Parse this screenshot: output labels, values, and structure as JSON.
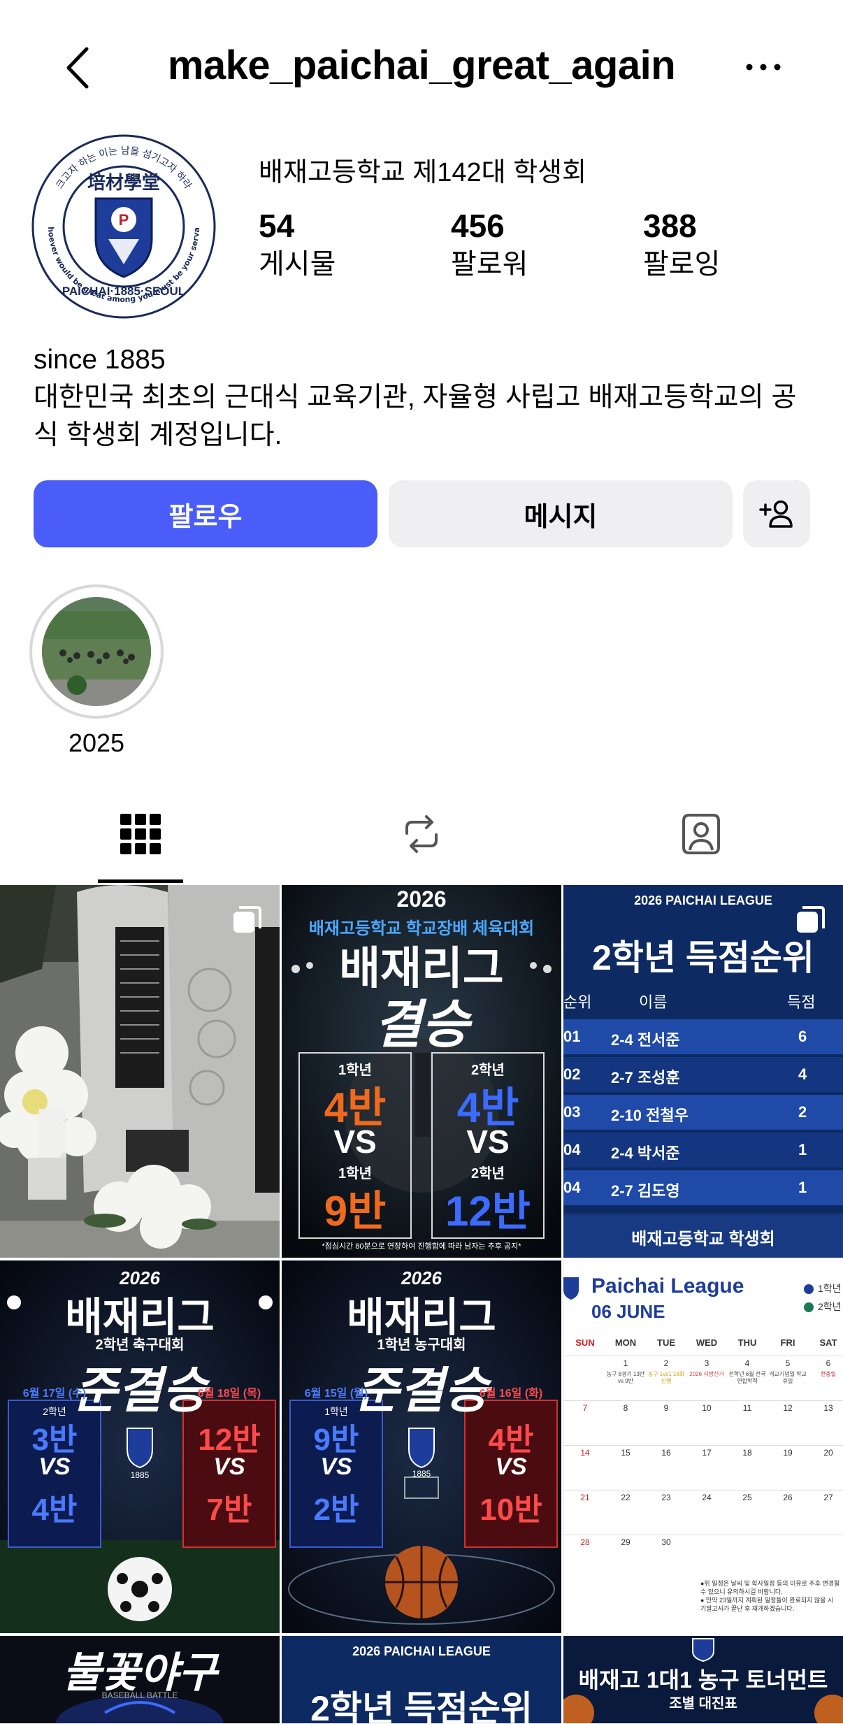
{
  "header": {
    "username": "make_paichai_great_again"
  },
  "profile": {
    "display_name": "배재고등학교 제142대 학생회",
    "stats": [
      {
        "value": "54",
        "label": "게시물"
      },
      {
        "value": "456",
        "label": "팔로워"
      },
      {
        "value": "388",
        "label": "팔로잉"
      }
    ],
    "avatar_text": {
      "top_arc": "크고자 하는 이는 남을 섬기고자 하라",
      "bottom_arc": "Whoever would be great among you must be your servant",
      "band": "PAICHAI·1885·SEOUL",
      "school": "培材學堂"
    },
    "bio_lines": [
      "since 1885",
      "대한민국 최초의 근대식 교육기관, 자율형 사립고 배재고등학교의 공",
      "식 학생회 계정입니다."
    ]
  },
  "actions": {
    "follow": "팔로우",
    "message": "메시지"
  },
  "highlights": [
    {
      "label": "2025"
    }
  ],
  "posts": {
    "p2": {
      "year": "2026",
      "subtitle": "배재고등학교 학교장배 체육대회",
      "title": "배재리그",
      "title2": "결승",
      "left_grade1": "1학년",
      "left_team1": "4반",
      "vs": "VS",
      "left_grade2": "1학년",
      "left_team2": "9반",
      "right_grade1": "2학년",
      "right_team1": "4반",
      "right_grade2": "2학년",
      "right_team2": "12반",
      "note": "*점심시간 80분으로 연장하여 진행함에 따라 남자는 추후 공지*"
    },
    "p3": {
      "league": "2026 PAICHAI LEAGUE",
      "title": "2학년 득점순위",
      "col_rank": "순위",
      "col_name": "이름",
      "col_score": "득점",
      "rows": [
        {
          "rank": "01",
          "name": "2-4 전서준",
          "score": "6"
        },
        {
          "rank": "02",
          "name": "2-7 조성훈",
          "score": "4"
        },
        {
          "rank": "03",
          "name": "2-10 전철우",
          "score": "2"
        },
        {
          "rank": "04",
          "name": "2-4 박서준",
          "score": "1"
        },
        {
          "rank": "04",
          "name": "2-7 김도영",
          "score": "1"
        }
      ],
      "footer": "배재고등학교 학생회"
    },
    "p4": {
      "year": "2026",
      "title": "배재리그",
      "subtitle": "2학년 축구대회",
      "stage": "준결승",
      "left_date": "6월 17일 (수)",
      "right_date": "6월 18일 (목)",
      "left_a": "3반",
      "left_b": "4반",
      "right_a": "12반",
      "right_b": "7반",
      "vs": "VS",
      "grade": "2학년",
      "founded": "1885"
    },
    "p5": {
      "year": "2026",
      "title": "배재리그",
      "subtitle": "1학년 농구대회",
      "stage": "준결승",
      "left_date": "6월 15일 (월)",
      "right_date": "6월 16일 (화)",
      "left_a": "9반",
      "left_b": "2반",
      "right_a": "4반",
      "right_b": "10반",
      "vs": "VS",
      "grade": "1학년",
      "founded": "1885"
    },
    "p6": {
      "title": "Paichai League",
      "month": "06 JUNE",
      "legend1": "1학년",
      "legend2": "2학년",
      "days": [
        "SUN",
        "MON",
        "TUE",
        "WED",
        "THU",
        "FRI",
        "SAT"
      ],
      "weeks": [
        [
          "",
          "1",
          "2",
          "3",
          "4",
          "5",
          "6"
        ],
        [
          "7",
          "8",
          "9",
          "10",
          "11",
          "12",
          "13"
        ],
        [
          "14",
          "15",
          "16",
          "17",
          "18",
          "19",
          "20"
        ],
        [
          "21",
          "22",
          "23",
          "24",
          "25",
          "26",
          "27"
        ],
        [
          "28",
          "29",
          "30",
          "",
          "",
          "",
          ""
        ]
      ],
      "notes": [
        "농구 8경기 13반 vs 9반",
        "농구 1vs1 16회 진행",
        "2026 지방선거",
        "전학년 6월 전국연합학력",
        "개교기념일 학교 휴일",
        "현충일"
      ],
      "footnote1": "●위 일정은 날씨 및 학사일정 등의 이유로 추후 변경될 수 있으니 유의하시길 바랍니다.",
      "footnote2": "● 만약 23일까지 계획된 일정들이 완료되지 않을 시 기말고사가 끝난 후 재개하겠습니다."
    },
    "p7": {
      "title": "불꽃야구",
      "subtitle": "BASEBALL BATTLE"
    },
    "p8": {
      "league": "2026 PAICHAI LEAGUE",
      "title": "2학년 득점순위"
    },
    "p9": {
      "title": "배재고 1대1 농구 토너먼트",
      "subtitle": "조별 대진표"
    }
  },
  "colors": {
    "accent": "#4a5df9",
    "button_gray": "#efeff1",
    "red": "#e03232",
    "blue_text": "#3b6bff"
  }
}
